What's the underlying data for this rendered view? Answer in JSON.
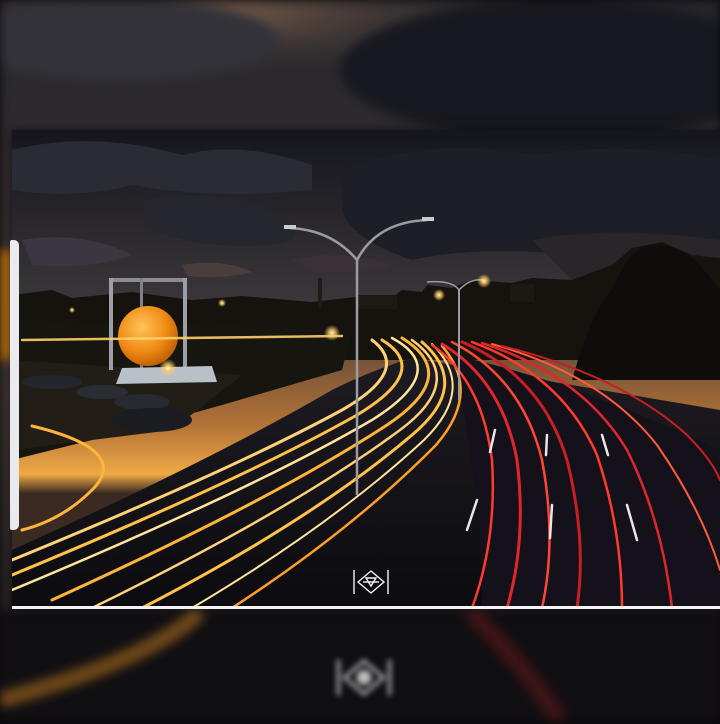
{
  "photo": {
    "subject": "night-highway-light-trails",
    "palette": {
      "sky_top": "#1b1d26",
      "sky_glow": "#e49a3a",
      "sun_sphere": "#f08a12",
      "trail_warm": "#ffcf6a",
      "trail_red": "#e0262a",
      "road": "#101014"
    }
  },
  "watermark": {
    "icon": "aperture-logo-icon"
  },
  "frame": {
    "border_color": "#f2f2f2"
  }
}
